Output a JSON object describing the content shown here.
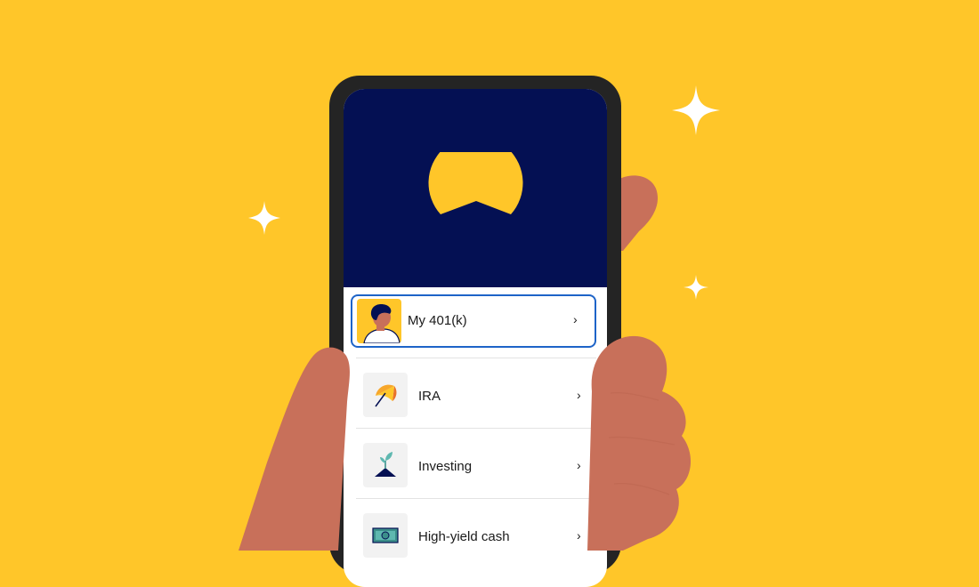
{
  "accounts": {
    "items": [
      {
        "label": "My 401(k)",
        "icon": "person-avatar-icon",
        "selected": true
      },
      {
        "label": "IRA",
        "icon": "umbrella-icon",
        "selected": false
      },
      {
        "label": "Investing",
        "icon": "sprout-icon",
        "selected": false
      },
      {
        "label": "High-yield cash",
        "icon": "cash-bill-icon",
        "selected": false
      }
    ]
  },
  "colors": {
    "background": "#FFC629",
    "header": "#041053",
    "accent_yellow": "#FFC629",
    "selection_border": "#1E64C8",
    "skin": "#C8705A"
  }
}
